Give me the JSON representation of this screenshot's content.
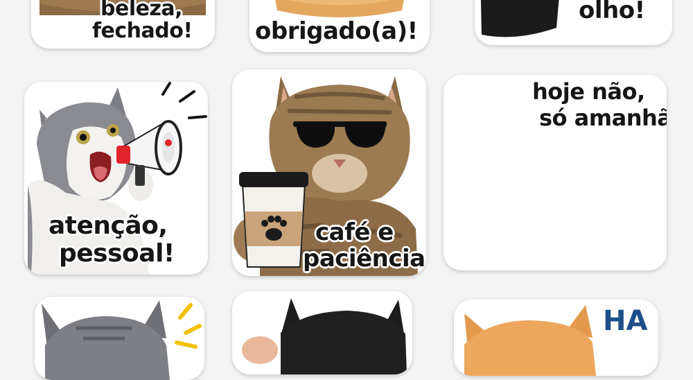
{
  "background_color": "#f3f3f3",
  "stickers": [
    {
      "id": "beleza",
      "line1": "beleza,",
      "line2": "fechado!"
    },
    {
      "id": "obrigado",
      "line1": "obrigado(a)!"
    },
    {
      "id": "olho",
      "line1": "olho!"
    },
    {
      "id": "atencao",
      "line1": "atenção,",
      "line2": "pessoal!"
    },
    {
      "id": "cafe",
      "line1": "café e",
      "line2": "paciência"
    },
    {
      "id": "hoje",
      "line1": "hoje não,",
      "line2": "só amanhã"
    },
    {
      "id": "gray-cat",
      "line1": ""
    },
    {
      "id": "black-cat",
      "line1": ""
    },
    {
      "id": "orange-cat",
      "line1": "HA"
    }
  ],
  "colors": {
    "caption_text": "#161616",
    "laugh_text": "#1f4f8a",
    "tabby": "#8b6a45",
    "gray": "#7d7f85",
    "blanket": "#d99a9a",
    "megaphone_red": "#e0242c",
    "cup_brown": "#c9a37a",
    "accent_yellow": "#f2c200"
  },
  "icons": [
    "megaphone-icon",
    "sunglasses-icon",
    "coffee-cup-icon",
    "paw-icon",
    "blanket-icon",
    "sparkle-icon"
  ]
}
